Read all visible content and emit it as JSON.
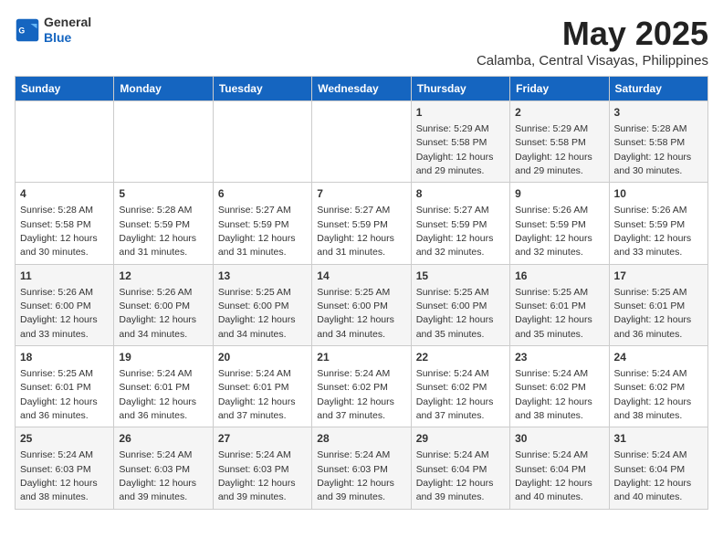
{
  "header": {
    "logo_line1": "General",
    "logo_line2": "Blue",
    "title": "May 2025",
    "subtitle": "Calamba, Central Visayas, Philippines"
  },
  "days_of_week": [
    "Sunday",
    "Monday",
    "Tuesday",
    "Wednesday",
    "Thursday",
    "Friday",
    "Saturday"
  ],
  "weeks": [
    [
      {
        "day": "",
        "info": ""
      },
      {
        "day": "",
        "info": ""
      },
      {
        "day": "",
        "info": ""
      },
      {
        "day": "",
        "info": ""
      },
      {
        "day": "1",
        "info": "Sunrise: 5:29 AM\nSunset: 5:58 PM\nDaylight: 12 hours\nand 29 minutes."
      },
      {
        "day": "2",
        "info": "Sunrise: 5:29 AM\nSunset: 5:58 PM\nDaylight: 12 hours\nand 29 minutes."
      },
      {
        "day": "3",
        "info": "Sunrise: 5:28 AM\nSunset: 5:58 PM\nDaylight: 12 hours\nand 30 minutes."
      }
    ],
    [
      {
        "day": "4",
        "info": "Sunrise: 5:28 AM\nSunset: 5:58 PM\nDaylight: 12 hours\nand 30 minutes."
      },
      {
        "day": "5",
        "info": "Sunrise: 5:28 AM\nSunset: 5:59 PM\nDaylight: 12 hours\nand 31 minutes."
      },
      {
        "day": "6",
        "info": "Sunrise: 5:27 AM\nSunset: 5:59 PM\nDaylight: 12 hours\nand 31 minutes."
      },
      {
        "day": "7",
        "info": "Sunrise: 5:27 AM\nSunset: 5:59 PM\nDaylight: 12 hours\nand 31 minutes."
      },
      {
        "day": "8",
        "info": "Sunrise: 5:27 AM\nSunset: 5:59 PM\nDaylight: 12 hours\nand 32 minutes."
      },
      {
        "day": "9",
        "info": "Sunrise: 5:26 AM\nSunset: 5:59 PM\nDaylight: 12 hours\nand 32 minutes."
      },
      {
        "day": "10",
        "info": "Sunrise: 5:26 AM\nSunset: 5:59 PM\nDaylight: 12 hours\nand 33 minutes."
      }
    ],
    [
      {
        "day": "11",
        "info": "Sunrise: 5:26 AM\nSunset: 6:00 PM\nDaylight: 12 hours\nand 33 minutes."
      },
      {
        "day": "12",
        "info": "Sunrise: 5:26 AM\nSunset: 6:00 PM\nDaylight: 12 hours\nand 34 minutes."
      },
      {
        "day": "13",
        "info": "Sunrise: 5:25 AM\nSunset: 6:00 PM\nDaylight: 12 hours\nand 34 minutes."
      },
      {
        "day": "14",
        "info": "Sunrise: 5:25 AM\nSunset: 6:00 PM\nDaylight: 12 hours\nand 34 minutes."
      },
      {
        "day": "15",
        "info": "Sunrise: 5:25 AM\nSunset: 6:00 PM\nDaylight: 12 hours\nand 35 minutes."
      },
      {
        "day": "16",
        "info": "Sunrise: 5:25 AM\nSunset: 6:01 PM\nDaylight: 12 hours\nand 35 minutes."
      },
      {
        "day": "17",
        "info": "Sunrise: 5:25 AM\nSunset: 6:01 PM\nDaylight: 12 hours\nand 36 minutes."
      }
    ],
    [
      {
        "day": "18",
        "info": "Sunrise: 5:25 AM\nSunset: 6:01 PM\nDaylight: 12 hours\nand 36 minutes."
      },
      {
        "day": "19",
        "info": "Sunrise: 5:24 AM\nSunset: 6:01 PM\nDaylight: 12 hours\nand 36 minutes."
      },
      {
        "day": "20",
        "info": "Sunrise: 5:24 AM\nSunset: 6:01 PM\nDaylight: 12 hours\nand 37 minutes."
      },
      {
        "day": "21",
        "info": "Sunrise: 5:24 AM\nSunset: 6:02 PM\nDaylight: 12 hours\nand 37 minutes."
      },
      {
        "day": "22",
        "info": "Sunrise: 5:24 AM\nSunset: 6:02 PM\nDaylight: 12 hours\nand 37 minutes."
      },
      {
        "day": "23",
        "info": "Sunrise: 5:24 AM\nSunset: 6:02 PM\nDaylight: 12 hours\nand 38 minutes."
      },
      {
        "day": "24",
        "info": "Sunrise: 5:24 AM\nSunset: 6:02 PM\nDaylight: 12 hours\nand 38 minutes."
      }
    ],
    [
      {
        "day": "25",
        "info": "Sunrise: 5:24 AM\nSunset: 6:03 PM\nDaylight: 12 hours\nand 38 minutes."
      },
      {
        "day": "26",
        "info": "Sunrise: 5:24 AM\nSunset: 6:03 PM\nDaylight: 12 hours\nand 39 minutes."
      },
      {
        "day": "27",
        "info": "Sunrise: 5:24 AM\nSunset: 6:03 PM\nDaylight: 12 hours\nand 39 minutes."
      },
      {
        "day": "28",
        "info": "Sunrise: 5:24 AM\nSunset: 6:03 PM\nDaylight: 12 hours\nand 39 minutes."
      },
      {
        "day": "29",
        "info": "Sunrise: 5:24 AM\nSunset: 6:04 PM\nDaylight: 12 hours\nand 39 minutes."
      },
      {
        "day": "30",
        "info": "Sunrise: 5:24 AM\nSunset: 6:04 PM\nDaylight: 12 hours\nand 40 minutes."
      },
      {
        "day": "31",
        "info": "Sunrise: 5:24 AM\nSunset: 6:04 PM\nDaylight: 12 hours\nand 40 minutes."
      }
    ]
  ]
}
